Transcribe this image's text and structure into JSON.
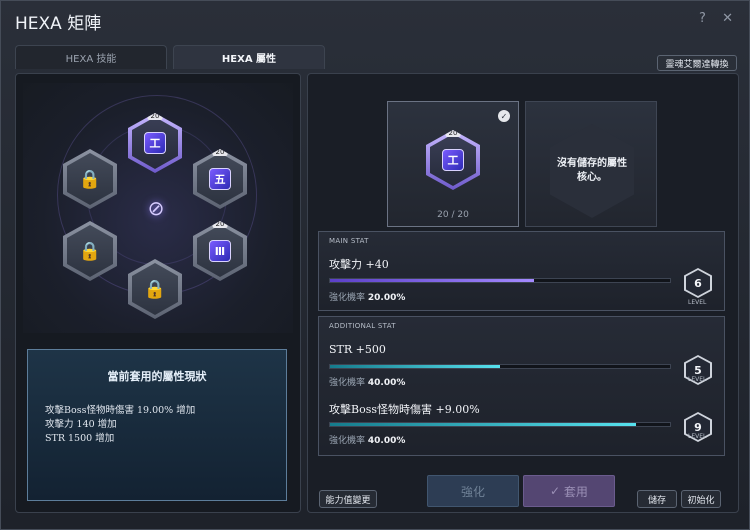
{
  "window": {
    "title": "HEXA 矩陣",
    "help_icon": "?",
    "close_icon": "✕"
  },
  "tabs": [
    {
      "label": "HEXA 技能"
    },
    {
      "label": "HEXA 屬性"
    }
  ],
  "convert_button": "靈魂艾爾達轉換",
  "matrix": {
    "core_level": "20",
    "core_glyphs": [
      "工",
      "五",
      "Ⅲ"
    ],
    "center_symbol": "⊘"
  },
  "status": {
    "title": "當前套用的屬性現狀",
    "lines": [
      "攻擊Boss怪物時傷害 19.00% 增加",
      "攻擊力 140 增加",
      "STR 1500 增加"
    ]
  },
  "cards": {
    "current_count": "20",
    "count_sep": "/",
    "max_count": "20",
    "no_core_text": "沒有儲存的屬性核心。"
  },
  "main_stat": {
    "header": "MAIN STAT",
    "name": "攻擊力 +40",
    "rate_label": "強化機率",
    "rate_value": "20.00%",
    "level": "6",
    "level_label": "LEVEL",
    "progress": 0.6
  },
  "additional_stat": {
    "header": "ADDITIONAL STAT",
    "items": [
      {
        "name": "STR +500",
        "rate_label": "強化機率",
        "rate_value": "40.00%",
        "level": "5",
        "level_label": "LEVEL",
        "progress": 0.5
      },
      {
        "name": "攻擊Boss怪物時傷害 +9.00%",
        "rate_label": "強化機率",
        "rate_value": "40.00%",
        "level": "9",
        "level_label": "LEVEL",
        "progress": 0.9
      }
    ]
  },
  "buttons": {
    "change": "能力值變更",
    "enhance": "強化",
    "apply": "套用",
    "save": "儲存",
    "reset": "初始化"
  },
  "colors": {
    "accent": "#8f7bff",
    "cyan": "#57e2ee"
  }
}
